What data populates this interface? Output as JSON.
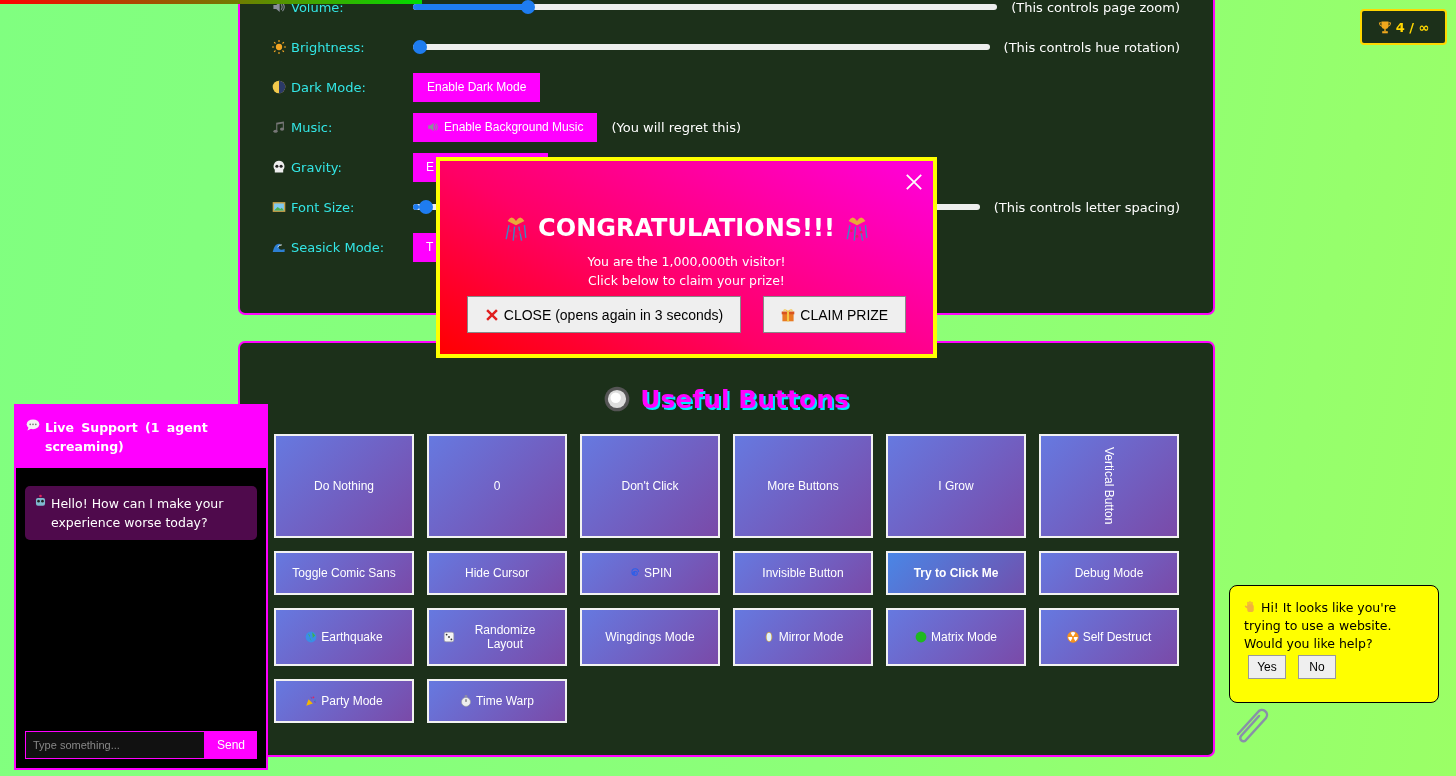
{
  "progress_bar": {
    "level": 0.29
  },
  "settings": {
    "rows": [
      {
        "kind": "slider",
        "label": "Volume:",
        "level": 0.19,
        "note": "(This controls page zoom)"
      },
      {
        "kind": "slider",
        "label": "Brightness:",
        "level": 0,
        "note": "(This controls hue rotation)"
      },
      {
        "kind": "button",
        "label": "Dark Mode:",
        "button": "Enable Dark Mode"
      },
      {
        "kind": "button",
        "label": "Music:",
        "button": "Enable Background Music",
        "note": "(You will regret this)"
      },
      {
        "kind": "button",
        "label": "Gravity:",
        "button": "E"
      },
      {
        "kind": "slider",
        "label": "Font Size:",
        "level": 0.01,
        "note": "(This controls letter spacing)"
      },
      {
        "kind": "button",
        "label": "Seasick Mode:",
        "button": "T"
      }
    ]
  },
  "useful_buttons": {
    "title": "Useful Buttons",
    "buttons": [
      {
        "label": "Do Nothing",
        "kind": "tall"
      },
      {
        "label": "0",
        "kind": "tall"
      },
      {
        "label": "Don't Click",
        "kind": "tall"
      },
      {
        "label": "More Buttons",
        "kind": "tall"
      },
      {
        "label": "I Grow",
        "kind": "tall"
      },
      {
        "label": "Vertical Button",
        "kind": "vertical"
      },
      {
        "label": "Toggle Comic Sans",
        "kind": "normal"
      },
      {
        "label": "Hide Cursor",
        "kind": "normal"
      },
      {
        "label": "SPIN",
        "kind": "normal"
      },
      {
        "label": "Invisible Button",
        "kind": "normal"
      },
      {
        "label": "Try to Click Me",
        "kind": "evasive"
      },
      {
        "label": "Debug Mode",
        "kind": "normal"
      },
      {
        "label": "Earthquake",
        "kind": "medium"
      },
      {
        "label": "Randomize Layout",
        "kind": "medium"
      },
      {
        "label": "Wingdings Mode",
        "kind": "medium"
      },
      {
        "label": "Mirror Mode",
        "kind": "medium"
      },
      {
        "label": "Matrix Mode",
        "kind": "medium"
      },
      {
        "label": "Self Destruct",
        "kind": "medium"
      },
      {
        "label": "Party Mode",
        "kind": "normal"
      },
      {
        "label": "Time Warp",
        "kind": "normal"
      }
    ]
  },
  "trophy_badge": {
    "text": "4 / ∞"
  },
  "popup": {
    "title": "CONGRATULATIONS!!!",
    "lines": [
      "You are the 1,000,000th visitor!",
      "Click below to claim your prize!"
    ],
    "buttons": [
      "CLOSE (opens again in 3 seconds)",
      "CLAIM PRIZE"
    ]
  },
  "live_support": {
    "title": "Live Support (1 agent screaming)",
    "messages": [
      "Hello! How can I make your experience worse today?"
    ],
    "input": {
      "placeholder": "Type something..."
    },
    "send": "Send"
  },
  "assistant": {
    "text": "Hi! It looks like you're trying to use a website. Would you like help?",
    "buttons": [
      "Yes",
      "No"
    ]
  }
}
